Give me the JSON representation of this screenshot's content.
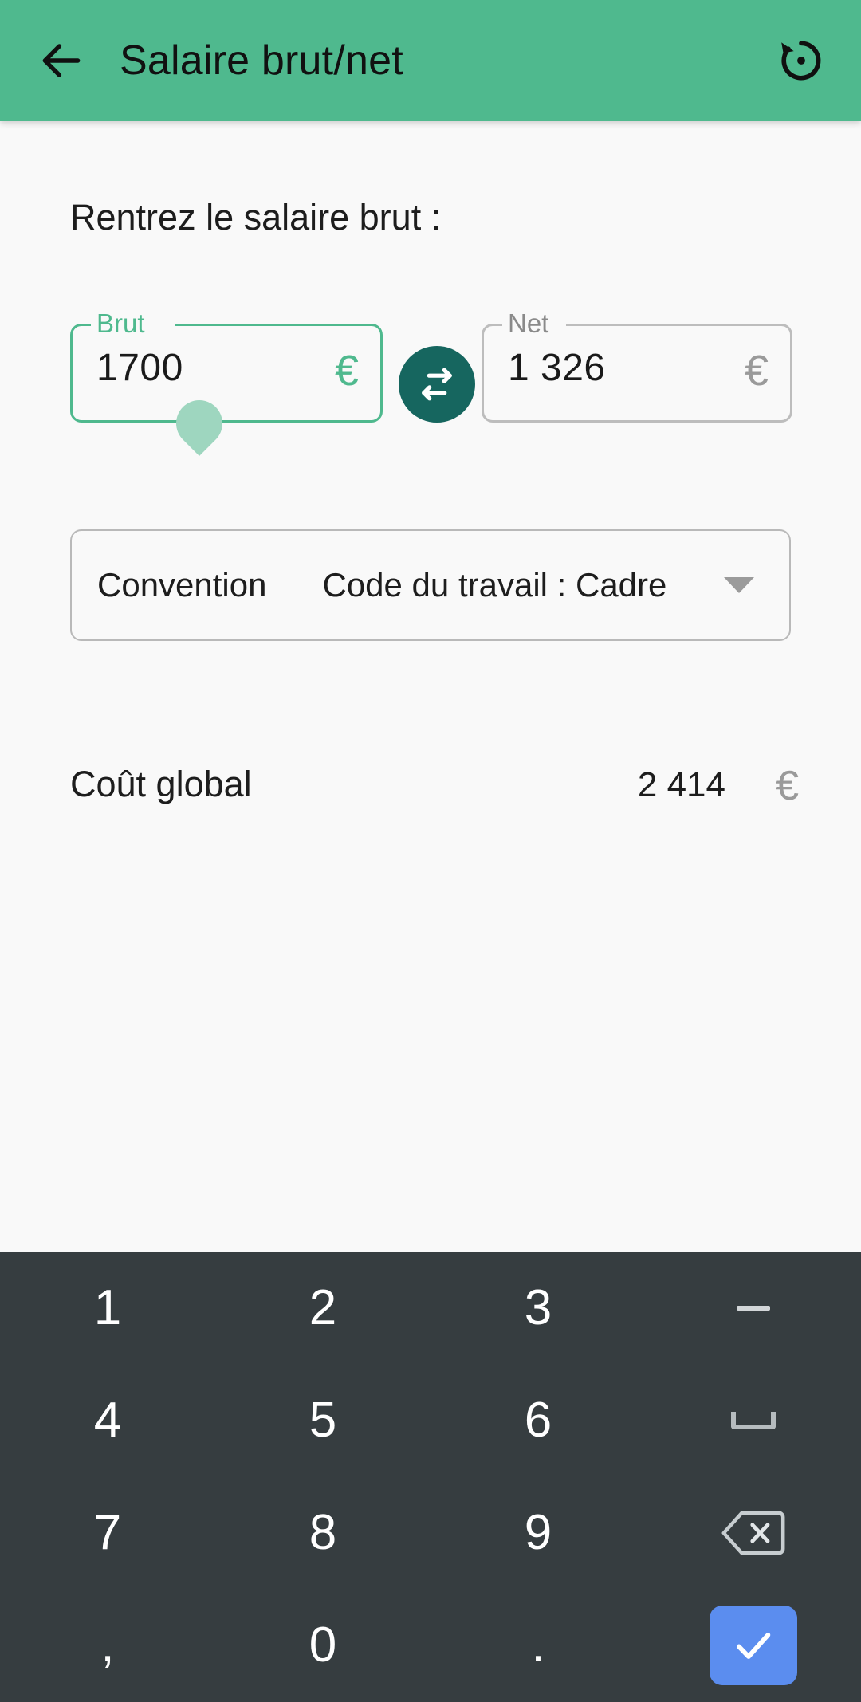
{
  "appbar": {
    "back_icon": "arrow-left-icon",
    "title": "Salaire brut/net",
    "action_icon": "restore-history-icon",
    "background_color": "#4fb98e"
  },
  "main": {
    "prompt": "Rentrez le salaire brut :",
    "fields": {
      "brut": {
        "label": "Brut",
        "value": "1700",
        "currency": "€",
        "focused": true,
        "accent_color": "#4fb98e"
      },
      "net": {
        "label": "Net",
        "value": "1 326",
        "currency": "€",
        "focused": false,
        "border_color": "#bdbdbd"
      }
    },
    "swap_button": {
      "icon": "swap-horizontal-icon",
      "color": "#16665f"
    },
    "convention": {
      "label": "Convention",
      "value": "Code du travail : Cadre",
      "caret_icon": "caret-down-icon"
    },
    "cost": {
      "label": "Coût global",
      "value": "2 414",
      "currency": "€"
    }
  },
  "keyboard": {
    "background_color": "#363d40",
    "enter_color": "#5b8def",
    "rows": [
      [
        {
          "label": "1",
          "type": "num",
          "name": "key-1"
        },
        {
          "label": "2",
          "type": "num",
          "name": "key-2"
        },
        {
          "label": "3",
          "type": "num",
          "name": "key-3"
        },
        {
          "label": "-",
          "type": "minus",
          "name": "key-minus"
        }
      ],
      [
        {
          "label": "4",
          "type": "num",
          "name": "key-4"
        },
        {
          "label": "5",
          "type": "num",
          "name": "key-5"
        },
        {
          "label": "6",
          "type": "num",
          "name": "key-6"
        },
        {
          "label": "",
          "type": "space",
          "name": "key-space"
        }
      ],
      [
        {
          "label": "7",
          "type": "num",
          "name": "key-7"
        },
        {
          "label": "8",
          "type": "num",
          "name": "key-8"
        },
        {
          "label": "9",
          "type": "num",
          "name": "key-9"
        },
        {
          "label": "",
          "type": "backspace",
          "name": "key-backspace"
        }
      ],
      [
        {
          "label": ",",
          "type": "num",
          "name": "key-comma"
        },
        {
          "label": "0",
          "type": "num",
          "name": "key-0"
        },
        {
          "label": ".",
          "type": "num",
          "name": "key-period"
        },
        {
          "label": "",
          "type": "enter",
          "name": "key-enter"
        }
      ]
    ]
  }
}
